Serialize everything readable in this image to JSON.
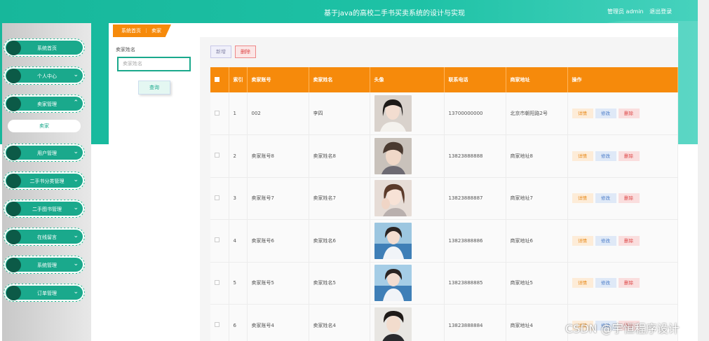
{
  "header": {
    "title": "基于java的高校二手书买卖系统的设计与实现",
    "user_label": "管理员 admin",
    "logout_label": "退出登录"
  },
  "sidebar": {
    "items": [
      {
        "label": "系统首页",
        "chevron": ""
      },
      {
        "label": "个人中心",
        "chevron": "⌄"
      },
      {
        "label": "卖家管理",
        "chevron": "⌃"
      },
      {
        "label": "用户管理",
        "chevron": "⌄"
      },
      {
        "label": "二手书分类管理",
        "chevron": "⌄"
      },
      {
        "label": "二手图书管理",
        "chevron": "⌄"
      },
      {
        "label": "在线留言",
        "chevron": "⌄"
      },
      {
        "label": "系统管理",
        "chevron": "⌄"
      },
      {
        "label": "订单管理",
        "chevron": "⌄"
      }
    ],
    "sub_item": "卖家"
  },
  "breadcrumb": {
    "home": "系统首页",
    "sep": "⋮",
    "current": "卖家"
  },
  "search": {
    "label": "卖家姓名",
    "placeholder": "卖家姓名",
    "button": "查询"
  },
  "toolbar": {
    "add": "新增",
    "delete": "删除"
  },
  "table": {
    "headers": [
      "",
      "索引",
      "卖家账号",
      "卖家姓名",
      "头像",
      "联系电话",
      "商家地址",
      "操作"
    ],
    "rows": [
      {
        "index": "1",
        "account": "002",
        "name": "李四",
        "phone": "13700000000",
        "address": "北京市朝阳路2号"
      },
      {
        "index": "2",
        "account": "卖家账号8",
        "name": "卖家姓名8",
        "phone": "13823888888",
        "address": "商家地址8"
      },
      {
        "index": "3",
        "account": "卖家账号7",
        "name": "卖家姓名7",
        "phone": "13823888887",
        "address": "商家地址7"
      },
      {
        "index": "4",
        "account": "卖家账号6",
        "name": "卖家姓名6",
        "phone": "13823888886",
        "address": "商家地址6"
      },
      {
        "index": "5",
        "account": "卖家账号5",
        "name": "卖家姓名5",
        "phone": "13823888885",
        "address": "商家地址5"
      },
      {
        "index": "6",
        "account": "卖家账号4",
        "name": "卖家姓名4",
        "phone": "13823888884",
        "address": "商家地址4"
      }
    ],
    "actions": {
      "detail": "详情",
      "edit": "修改",
      "delete": "删除"
    }
  },
  "watermark": "CSDN @宇恒程序设计",
  "colors": {
    "primary": "#1aa98c",
    "accent": "#f68a0b"
  }
}
